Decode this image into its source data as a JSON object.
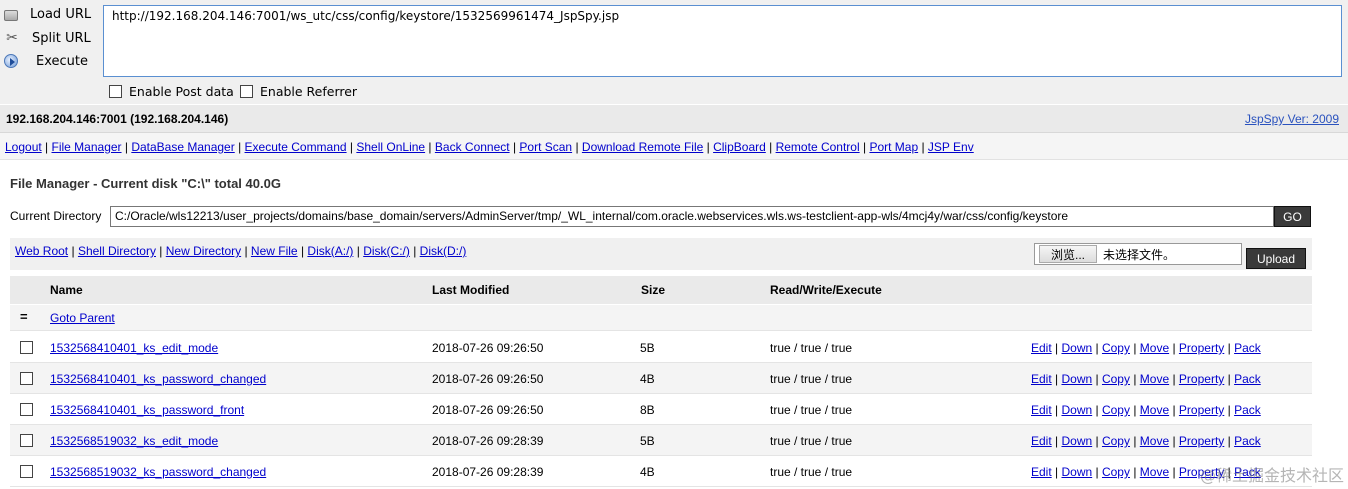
{
  "hackbar": {
    "load_url": "Load URL",
    "split_url": "Split URL",
    "execute": "Execute",
    "url": "http://192.168.204.146:7001/ws_utc/css/config/keystore/1532569961474_JspSpy.jsp",
    "enable_post": "Enable Post data",
    "enable_referrer": "Enable Referrer"
  },
  "header": {
    "host": "192.168.204.146:7001 (192.168.204.146)",
    "version": "JspSpy Ver: 2009"
  },
  "nav": [
    "Logout",
    "File Manager",
    "DataBase Manager",
    "Execute Command",
    "Shell OnLine",
    "Back Connect",
    "Port Scan",
    "Download Remote File",
    "ClipBoard",
    "Remote Control",
    "Port Map",
    "JSP Env"
  ],
  "file_manager": {
    "title": "File Manager - Current disk \"C:\\\" total 40.0G",
    "current_dir_label": "Current Directory",
    "current_dir": "C:/Oracle/wls12213/user_projects/domains/base_domain/servers/AdminServer/tmp/_WL_internal/com.oracle.webservices.wls.ws-testclient-app-wls/4mcj4y/war/css/config/keystore",
    "go_label": "GO",
    "quick_links": [
      "Web Root",
      "Shell Directory",
      "New Directory",
      "New File",
      "Disk(A:/)",
      "Disk(C:/)",
      "Disk(D:/)"
    ],
    "browse_label": "浏览...",
    "file_status": "未选择文件。",
    "upload_label": "Upload"
  },
  "table": {
    "headers": {
      "name": "Name",
      "modified": "Last Modified",
      "size": "Size",
      "rwe": "Read/Write/Execute"
    },
    "parent_symbol": "=",
    "parent_label": "Goto Parent",
    "actions": [
      "Edit",
      "Down",
      "Copy",
      "Move",
      "Property",
      "Pack"
    ],
    "rows": [
      {
        "name": "1532568410401_ks_edit_mode",
        "modified": "2018-07-26 09:26:50",
        "size": "5B",
        "rwe": "true / true / true"
      },
      {
        "name": "1532568410401_ks_password_changed",
        "modified": "2018-07-26 09:26:50",
        "size": "4B",
        "rwe": "true / true / true"
      },
      {
        "name": "1532568410401_ks_password_front",
        "modified": "2018-07-26 09:26:50",
        "size": "8B",
        "rwe": "true / true / true"
      },
      {
        "name": "1532568519032_ks_edit_mode",
        "modified": "2018-07-26 09:28:39",
        "size": "5B",
        "rwe": "true / true / true"
      },
      {
        "name": "1532568519032_ks_password_changed",
        "modified": "2018-07-26 09:28:39",
        "size": "4B",
        "rwe": "true / true / true"
      }
    ]
  },
  "watermark": "@稀土掘金技术社区"
}
